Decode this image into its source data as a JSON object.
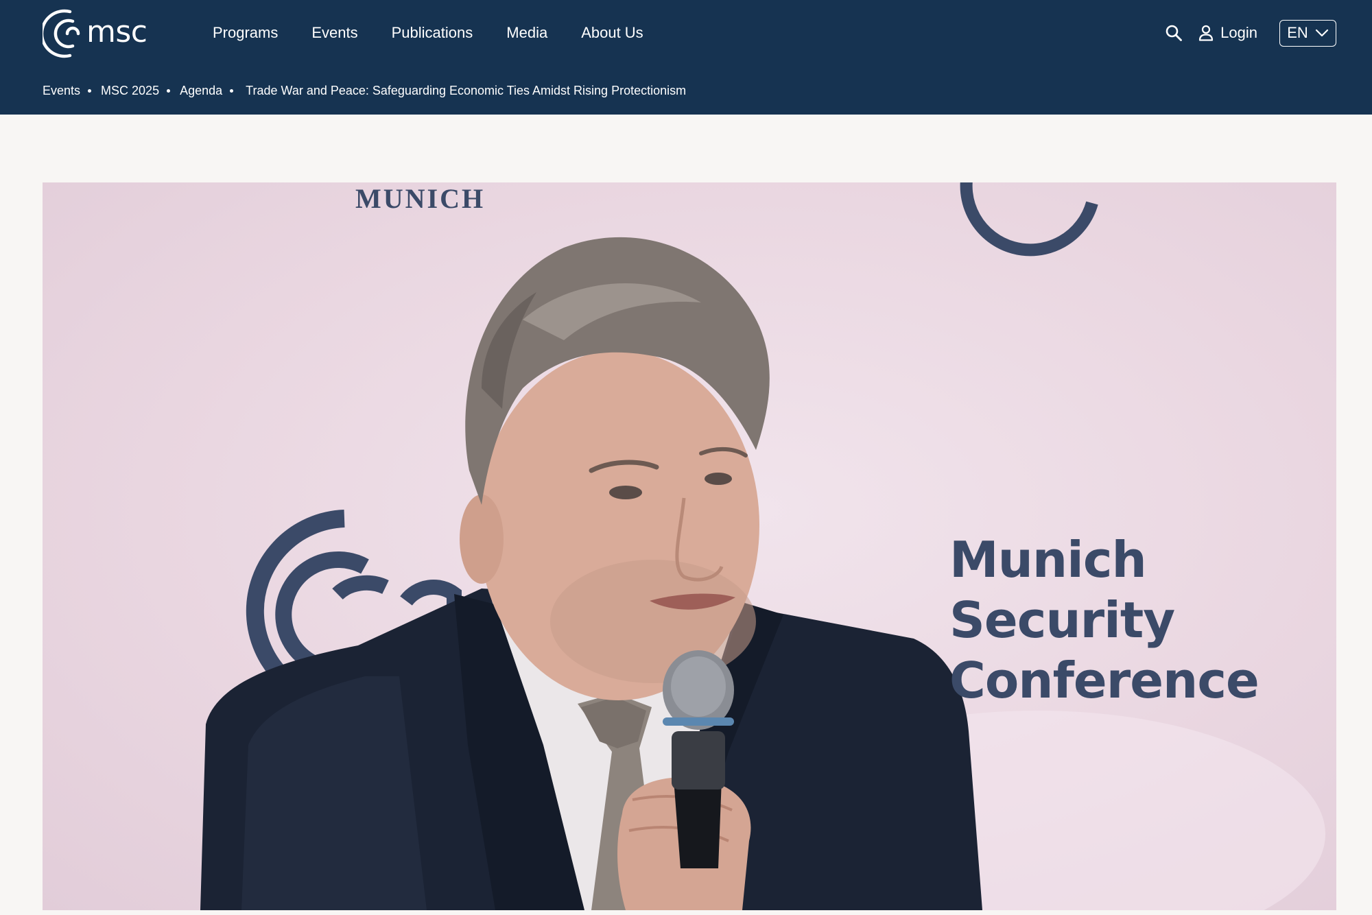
{
  "brand": {
    "logo_text": "msc"
  },
  "nav": {
    "items": [
      "Programs",
      "Events",
      "Publications",
      "Media",
      "About Us"
    ]
  },
  "tools": {
    "login_label": "Login",
    "language": "EN"
  },
  "breadcrumb": {
    "items": [
      "Events",
      "MSC 2025",
      "Agenda"
    ],
    "current": "Trade War and Peace: Safeguarding Economic Ties Amidst Rising Protectionism"
  },
  "hero": {
    "backdrop_word": "MUNICH",
    "backdrop_line1": "Munich Security",
    "backdrop_line2": "Conference"
  },
  "colors": {
    "header_bg": "#163351",
    "page_bg": "#f8f6f4",
    "brand_navy": "#3b4a68"
  }
}
